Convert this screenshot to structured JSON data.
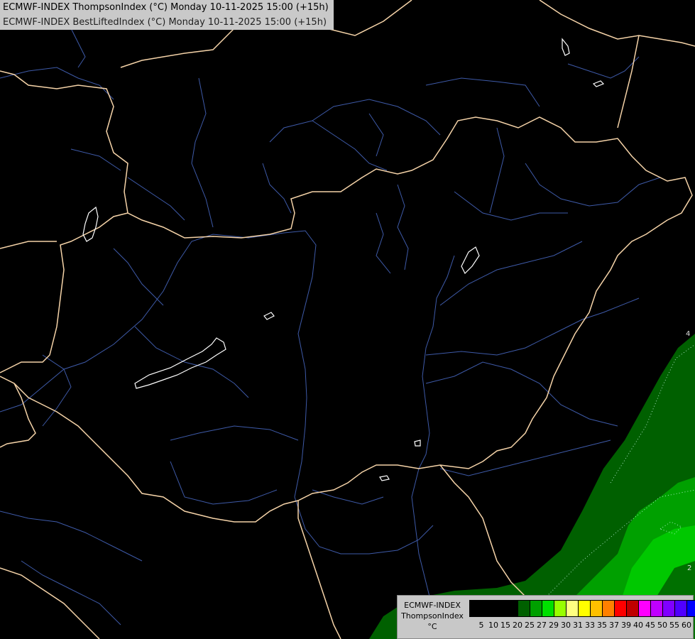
{
  "header": {
    "line1": "ECMWF-INDEX ThompsonIndex (°C) Monday 10-11-2025 15:00 (+15h)",
    "line2": "ECMWF-INDEX BestLiftedIndex (°C) Monday 10-11-2025 15:00 (+15h)"
  },
  "legend": {
    "title1": "ECMWF-INDEX",
    "title2": "ThompsonIndex",
    "unit": "°C",
    "colors": [
      "#000000",
      "#000000",
      "#000000",
      "#000000",
      "#006000",
      "#00a000",
      "#00e000",
      "#98ff00",
      "#ffff80",
      "#ffff00",
      "#ffc000",
      "#ff8000",
      "#ff0000",
      "#c00000",
      "#ff00ff",
      "#c000ff",
      "#8000ff",
      "#5000ff",
      "#0000ff"
    ],
    "ticks": [
      "5",
      "10",
      "15",
      "20",
      "25",
      "27",
      "29",
      "30",
      "31",
      "33",
      "35",
      "37",
      "39",
      "40",
      "45",
      "50",
      "55",
      "60"
    ]
  },
  "map": {
    "contour_labels": [
      "4",
      "2"
    ],
    "colors": {
      "border": "#f5d3a8",
      "river": "#3e5aa8",
      "lake": "#ffffff",
      "field_dark": "#006000",
      "field_mid": "#00a000",
      "field_light": "#00c800"
    }
  }
}
